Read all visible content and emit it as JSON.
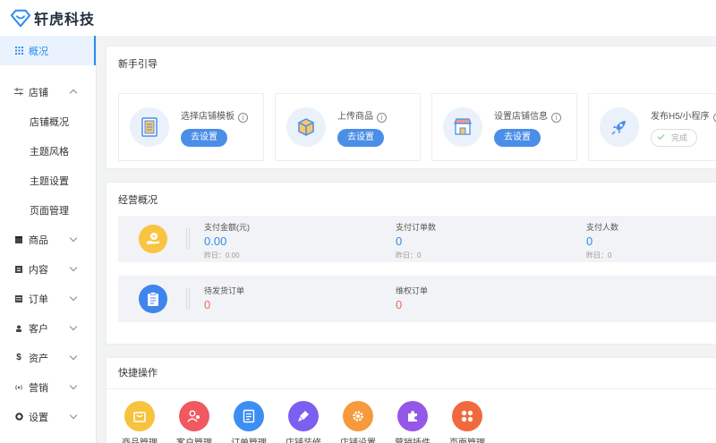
{
  "brand": {
    "name": "轩虎科技",
    "logo_icon": "diamond-heart-logo"
  },
  "sidebar": {
    "items": [
      {
        "label": "概况",
        "icon": "grid-icon",
        "active": true
      },
      {
        "label": "店铺",
        "icon": "shop-sliders-icon",
        "expanded": true,
        "children": [
          "店铺概况",
          "主题风格",
          "主题设置",
          "页面管理"
        ]
      },
      {
        "label": "商品",
        "icon": "box-icon"
      },
      {
        "label": "内容",
        "icon": "doc-icon"
      },
      {
        "label": "订单",
        "icon": "list-icon"
      },
      {
        "label": "客户",
        "icon": "user-icon"
      },
      {
        "label": "资产",
        "icon": "dollar-icon"
      },
      {
        "label": "营销",
        "icon": "broadcast-icon"
      },
      {
        "label": "设置",
        "icon": "gear-icon"
      }
    ]
  },
  "guide": {
    "title": "新手引导",
    "items": [
      {
        "label": "选择店铺模板",
        "button": "去设置",
        "icon": "template-icon"
      },
      {
        "label": "上传商品",
        "button": "去设置",
        "icon": "cube-icon"
      },
      {
        "label": "设置店铺信息",
        "button": "去设置",
        "icon": "storefront-icon"
      },
      {
        "label": "发布H5/小程序",
        "button": "完成",
        "done": true,
        "icon": "rocket-icon"
      }
    ]
  },
  "overview": {
    "title": "经营概况",
    "row1": {
      "icon": "money-hand-icon",
      "stats": [
        {
          "label": "支付金额(元)",
          "value": "0.00",
          "yesterday": "昨日：0.00"
        },
        {
          "label": "支付订单数",
          "value": "0",
          "yesterday": "昨日：0"
        },
        {
          "label": "支付人数",
          "value": "0",
          "yesterday": "昨日：0"
        }
      ]
    },
    "row2": {
      "icon": "clipboard-icon",
      "stats": [
        {
          "label": "待发货订单",
          "value": "0"
        },
        {
          "label": "维权订单",
          "value": "0"
        }
      ]
    }
  },
  "quick": {
    "title": "快捷操作",
    "items": [
      {
        "label": "商品管理",
        "color": "#f7c23e"
      },
      {
        "label": "客户管理",
        "color": "#f0595f"
      },
      {
        "label": "订单管理",
        "color": "#3d8ef3"
      },
      {
        "label": "店铺装修",
        "color": "#7c5ff0"
      },
      {
        "label": "店铺设置",
        "color": "#f79a3d"
      },
      {
        "label": "营销插件",
        "color": "#9557e8"
      },
      {
        "label": "页面管理",
        "color": "#f2693d"
      }
    ]
  },
  "colors": {
    "accent": "#2d8cf0",
    "button": "#4a8ee8",
    "value_red": "#ed6b5b"
  }
}
